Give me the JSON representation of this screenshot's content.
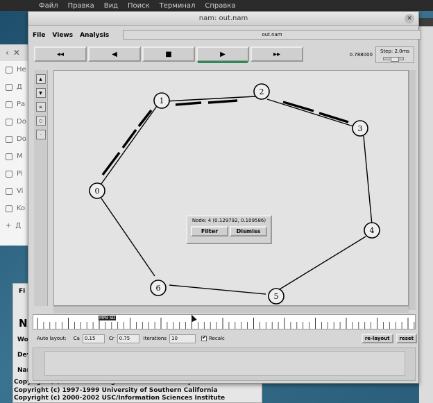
{
  "host_menu": [
    "Файл",
    "Правка",
    "Вид",
    "Поиск",
    "Терминал",
    "Справка"
  ],
  "background_file_manager": {
    "items": [
      "Не",
      "Д",
      "Ра",
      "Do",
      "Do",
      "M",
      "Pi",
      "Vi",
      "Ko",
      "Д"
    ]
  },
  "background_about": {
    "title": "NA",
    "labels": [
      "Wo",
      "Dev",
      "Nar"
    ],
    "copyright": [
      "Copyright (c) 1997-1994 Regents of the University of California",
      "Copyright (c) 1997-1999 University of Southern California",
      "Copyright (c) 2000-2002 USC/Information Sciences Institute"
    ],
    "tab_label": "Fi"
  },
  "nam": {
    "title": "nam: out.nam",
    "menus": [
      "File",
      "Views",
      "Analysis"
    ],
    "file_field": "out.nam",
    "controls": {
      "rewind": "◂◂",
      "back": "◀",
      "stop": "■",
      "play": "▶",
      "forward": "▸▸"
    },
    "time": "0.788000",
    "step": "Step: 2.0ms",
    "tools": [
      "zoom-in",
      "zoom-out",
      "edit",
      "ellipse",
      "point"
    ],
    "nodes": [
      "0",
      "1",
      "2",
      "3",
      "4",
      "5",
      "6"
    ],
    "popup": {
      "label": "Node: 4 (0.129792, 0.109586)",
      "filter": "Filter",
      "dismiss": "Dismiss"
    },
    "timeline_marker": "MPB SD",
    "layout": {
      "auto_layout": "Auto layout:",
      "ca_label": "Ca",
      "ca_value": "0.15",
      "cr_label": "Cr",
      "cr_value": "0.75",
      "iterations_label": "Iterations",
      "iterations_value": "10",
      "recalc": "Recalc",
      "relayout": "re-layout",
      "reset": "reset"
    }
  }
}
